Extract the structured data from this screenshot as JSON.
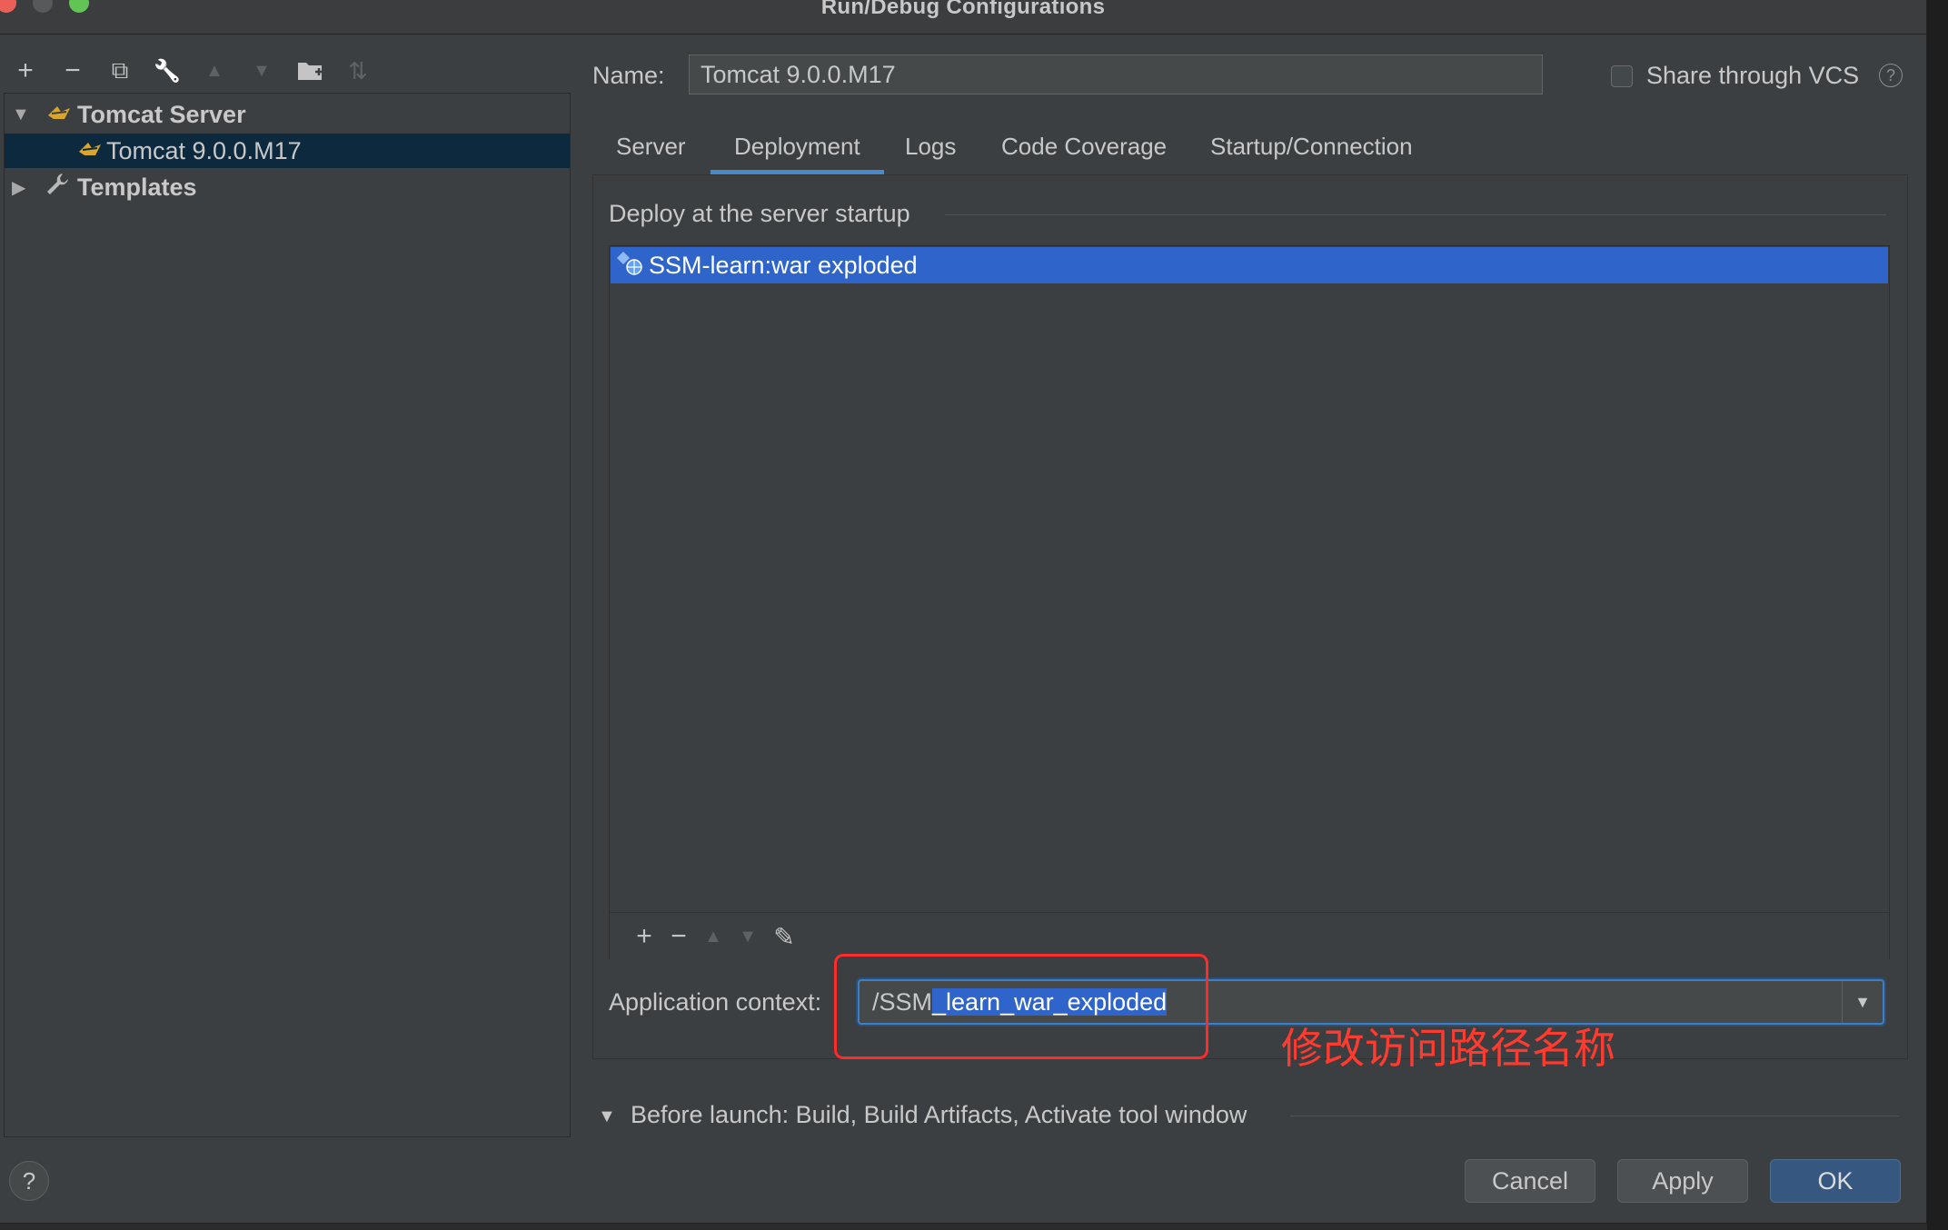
{
  "window": {
    "title": "Run/Debug Configurations"
  },
  "left_toolbar": {
    "icons": [
      "add-icon",
      "remove-icon",
      "copy-icon",
      "wrench-icon",
      "move-up-icon",
      "move-down-icon",
      "new-folder-icon",
      "sort-icon"
    ],
    "glyphs": {
      "add": "+",
      "remove": "−",
      "copy": "⧉",
      "wrench": "🔧",
      "up": "▲",
      "down": "▼",
      "folder": "▸",
      "sort": "⇅"
    }
  },
  "tree": {
    "items": [
      {
        "label": "Tomcat Server",
        "expanded": true,
        "arrow": "▼",
        "icon": "tomcat-icon"
      },
      {
        "label": "Tomcat 9.0.0.M17",
        "selected": true,
        "icon": "tomcat-icon"
      },
      {
        "label": "Templates",
        "expanded": false,
        "arrow": "▶",
        "icon": "wrench-icon"
      }
    ]
  },
  "form": {
    "name_label": "Name:",
    "name_value": "Tomcat 9.0.0.M17",
    "share_label": "Share through VCS",
    "share_checked": false,
    "help_glyph": "?"
  },
  "tabs": [
    {
      "label": "Server",
      "active": false
    },
    {
      "label": "Deployment",
      "active": true
    },
    {
      "label": "Logs",
      "active": false
    },
    {
      "label": "Code Coverage",
      "active": false
    },
    {
      "label": "Startup/Connection",
      "active": false
    }
  ],
  "deployment": {
    "heading": "Deploy at the server startup",
    "items": [
      {
        "label": "SSM-learn:war exploded",
        "selected": true,
        "icon": "artifact-icon"
      }
    ],
    "toolbar_glyphs": {
      "add": "+",
      "remove": "−",
      "up": "▲",
      "down": "▼",
      "edit": "✎"
    },
    "context_label": "Application context:",
    "context_prefix": "/SSM",
    "context_selected": "_learn_war_exploded",
    "dropdown_glyph": "▼"
  },
  "annotation": {
    "text": "修改访问路径名称",
    "color": "#ff3b30"
  },
  "before_launch": {
    "arrow": "▼",
    "label": "Before launch: Build, Build Artifacts, Activate tool window"
  },
  "buttons": {
    "cancel": "Cancel",
    "apply": "Apply",
    "ok": "OK",
    "help": "?"
  },
  "colors": {
    "accent": "#2f65ca",
    "tab_underline": "#4a88c7",
    "annotation": "#ff2a2a"
  }
}
